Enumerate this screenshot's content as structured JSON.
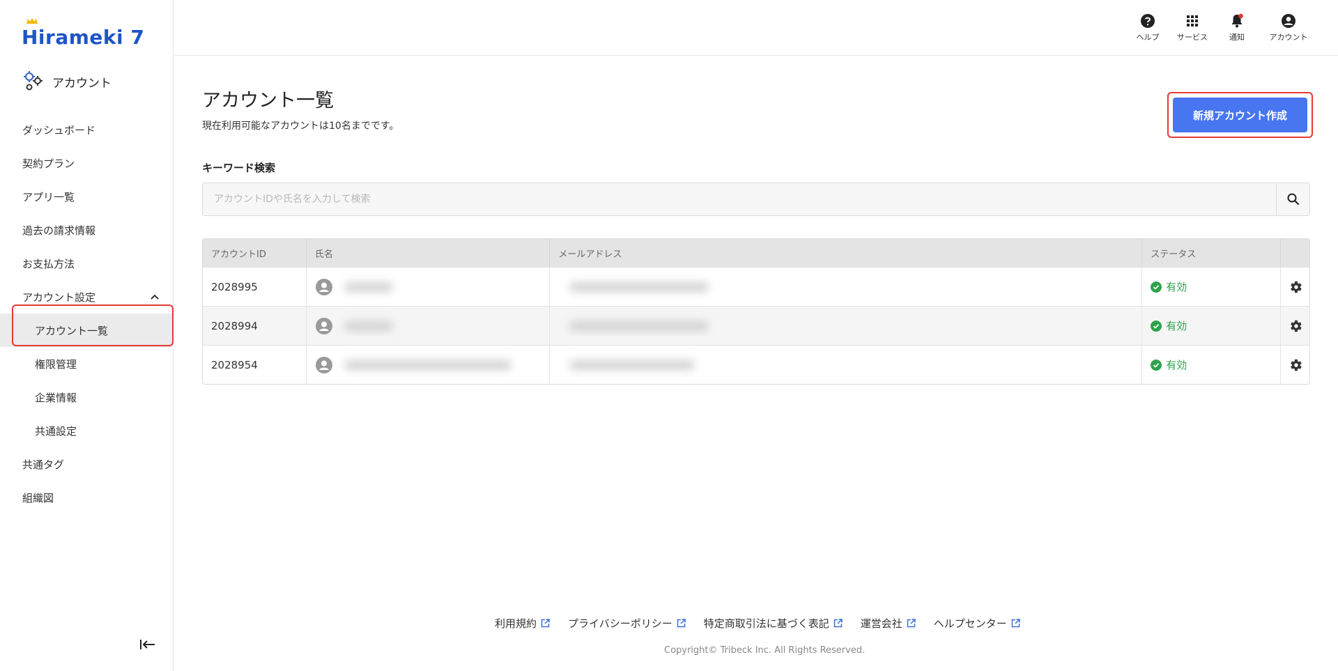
{
  "brand": {
    "logo_text": "Hirameki 7",
    "accent_color": "#4876f0",
    "logo_color": "#1f54c9"
  },
  "sidebar": {
    "section_title": "アカウント",
    "items": [
      {
        "label": "ダッシュボード"
      },
      {
        "label": "契約プラン"
      },
      {
        "label": "アプリ一覧"
      },
      {
        "label": "過去の請求情報"
      },
      {
        "label": "お支払方法"
      },
      {
        "label": "アカウント設定",
        "expanded": true
      },
      {
        "label": "アカウント一覧",
        "active": true
      },
      {
        "label": "権限管理"
      },
      {
        "label": "企業情報"
      },
      {
        "label": "共通設定"
      },
      {
        "label": "共通タグ"
      },
      {
        "label": "組織図"
      }
    ]
  },
  "topbar": {
    "help": "ヘルプ",
    "services": "サービス",
    "notifications": "通知",
    "account": "アカウント"
  },
  "page": {
    "title": "アカウント一覧",
    "subtitle": "現在利用可能なアカウントは10名までです。",
    "new_button": "新規アカウント作成",
    "keyword_label": "キーワード検索",
    "search_placeholder": "アカウントIDや氏名を入力して検索"
  },
  "table": {
    "headers": [
      "アカウントID",
      "氏名",
      "メールアドレス",
      "ステータス",
      ""
    ],
    "rows": [
      {
        "id": "2028995",
        "status": "有効"
      },
      {
        "id": "2028994",
        "status": "有効"
      },
      {
        "id": "2028954",
        "status": "有効"
      }
    ]
  },
  "footer": {
    "links": [
      "利用規約",
      "プライバシーポリシー",
      "特定商取引法に基づく表記",
      "運営会社",
      "ヘルプセンター"
    ],
    "copyright": "Copyright© Tribeck Inc. All Rights Reserved."
  }
}
